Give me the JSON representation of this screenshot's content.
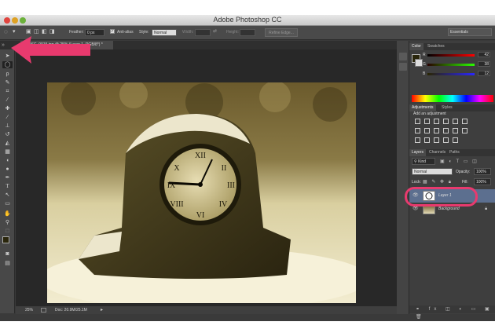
{
  "window": {
    "title": "Adobe Photoshop CC"
  },
  "options_bar": {
    "feather_label": "Feather:",
    "feather_value": "0 px",
    "antialias_label": "Anti-alias",
    "style_label": "Style:",
    "style_value": "Normal",
    "width_label": "Width:",
    "height_label": "Height:",
    "refine_edge_label": "Refine Edge...",
    "workspace_value": "Essentials"
  },
  "document_tab": {
    "label": "DSC_0015.jpg @ 25% (Layer 1, RGB/8*) *"
  },
  "status_bar": {
    "zoom": "25%",
    "doc_size": "Doc: 20.9M/25.1M"
  },
  "color_panel": {
    "tabs": [
      "Color",
      "Swatches"
    ],
    "channels": [
      {
        "label": "R",
        "value": "42",
        "gradient": "linear-gradient(90deg,#000,#f00)"
      },
      {
        "label": "G",
        "value": "38",
        "gradient": "linear-gradient(90deg,#2a0000,#2aff00)"
      },
      {
        "label": "B",
        "value": "12",
        "gradient": "linear-gradient(90deg,#2a2600,#2a26ff)"
      }
    ],
    "foreground_color": "#2a260c"
  },
  "adjustments_panel": {
    "tabs": [
      "Adjustments",
      "Styles"
    ],
    "heading": "Add an adjustment"
  },
  "layers_panel": {
    "tabs": [
      "Layers",
      "Channels",
      "Paths"
    ],
    "kind_label": "Kind",
    "blend_mode": "Normal",
    "opacity_label": "Opacity:",
    "opacity_value": "100%",
    "lock_label": "Lock:",
    "fill_label": "Fill:",
    "fill_value": "100%",
    "layers": [
      {
        "name": "Layer 1",
        "selected": true
      },
      {
        "name": "Background",
        "selected": false
      }
    ]
  },
  "annotation_color": "#e83a6e"
}
